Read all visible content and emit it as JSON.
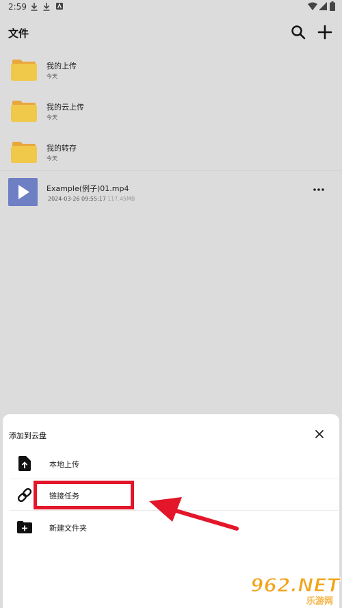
{
  "status_bar": {
    "time": "2:59"
  },
  "header": {
    "title": "文件"
  },
  "folders": [
    {
      "name": "我的上传",
      "date": "今天"
    },
    {
      "name": "我的云上传",
      "date": "今天"
    },
    {
      "name": "我的转存",
      "date": "今天"
    }
  ],
  "video": {
    "name": "Example(例子)01.mp4",
    "date": "2024-03-26 09:55:17",
    "size": "117.45MB"
  },
  "sheet": {
    "title": "添加到云盘",
    "options": [
      {
        "label": "本地上传",
        "icon": "file-upload-icon"
      },
      {
        "label": "链接任务",
        "icon": "link-icon"
      },
      {
        "label": "新建文件夹",
        "icon": "folder-add-icon"
      }
    ]
  },
  "watermark": {
    "text": "962.NET",
    "sub": "乐游网"
  },
  "colors": {
    "folder": "#f0c84a",
    "video_thumb": "#6f7fc4",
    "highlight": "#e3162a"
  }
}
